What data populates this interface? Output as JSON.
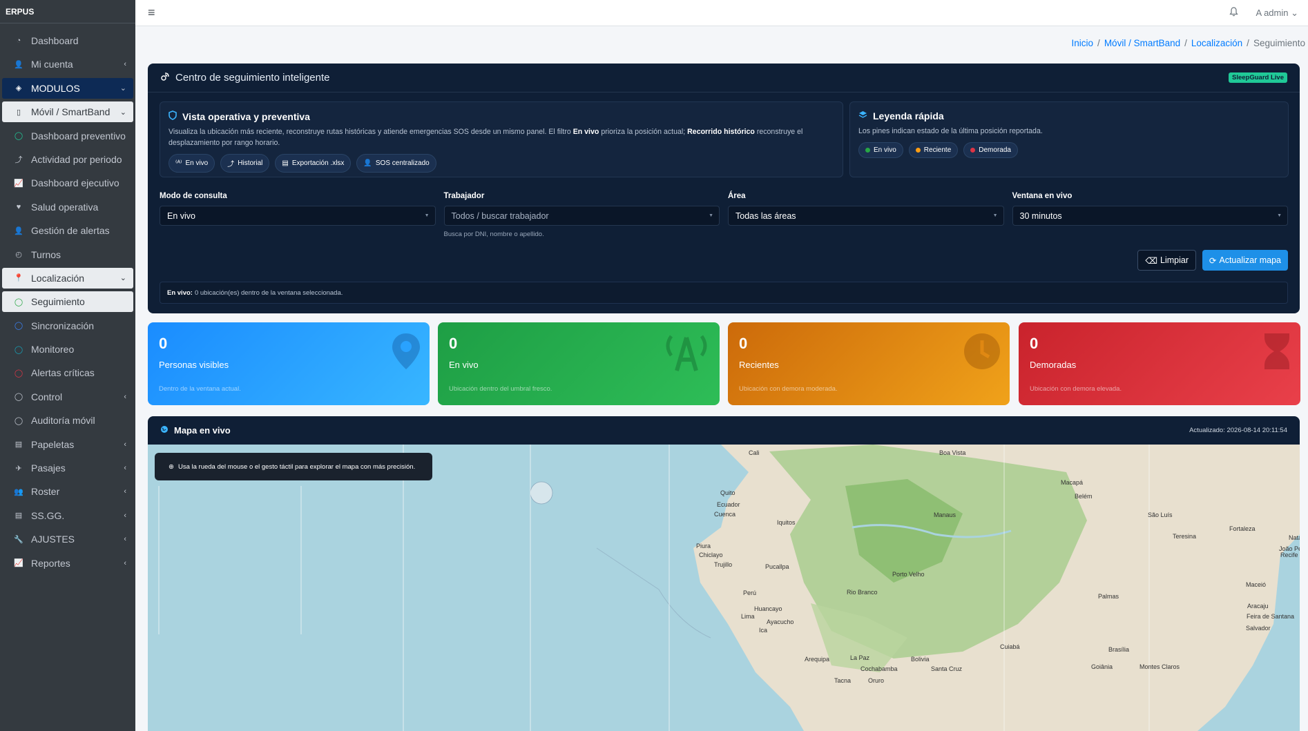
{
  "app": {
    "brand": "ERPUS"
  },
  "sidebar": {
    "items": [
      {
        "label": "Dashboard",
        "icon": "dashboard-icon",
        "arrow": ""
      },
      {
        "label": "Mi cuenta",
        "icon": "user-icon",
        "arrow": "‹"
      },
      {
        "label": "MODULOS",
        "icon": "layers-icon",
        "arrow": "⌄"
      },
      {
        "label": "Móvil / SmartBand",
        "icon": "mobile-icon",
        "arrow": "⌄"
      },
      {
        "label": "Dashboard preventivo",
        "icon": "circle-icon",
        "arrow": ""
      },
      {
        "label": "Actividad por periodo",
        "icon": "route-icon",
        "arrow": ""
      },
      {
        "label": "Dashboard ejecutivo",
        "icon": "chart-icon",
        "arrow": ""
      },
      {
        "label": "Salud operativa",
        "icon": "heart-icon",
        "arrow": ""
      },
      {
        "label": "Gestión de alertas",
        "icon": "user-gear-icon",
        "arrow": ""
      },
      {
        "label": "Turnos",
        "icon": "clock-icon",
        "arrow": ""
      },
      {
        "label": "Localización",
        "icon": "map-pin-icon",
        "arrow": "⌄"
      },
      {
        "label": "Seguimiento",
        "icon": "circle-icon",
        "arrow": ""
      },
      {
        "label": "Sincronización",
        "icon": "circle-icon",
        "arrow": ""
      },
      {
        "label": "Monitoreo",
        "icon": "circle-icon",
        "arrow": ""
      },
      {
        "label": "Alertas críticas",
        "icon": "circle-icon",
        "arrow": ""
      },
      {
        "label": "Control",
        "icon": "circle-icon",
        "arrow": "‹"
      },
      {
        "label": "Auditoría móvil",
        "icon": "circle-icon",
        "arrow": ""
      },
      {
        "label": "Papeletas",
        "icon": "document-icon",
        "arrow": "‹"
      },
      {
        "label": "Pasajes",
        "icon": "plane-icon",
        "arrow": "‹"
      },
      {
        "label": "Roster",
        "icon": "users-icon",
        "arrow": "‹"
      },
      {
        "label": "SS.GG.",
        "icon": "document-icon",
        "arrow": "‹"
      },
      {
        "label": "AJUSTES",
        "icon": "wrench-icon",
        "arrow": "‹"
      },
      {
        "label": "Reportes",
        "icon": "chart-icon",
        "arrow": "‹"
      }
    ]
  },
  "topbar": {
    "user": "A  admin ⌄"
  },
  "breadcrumb": {
    "home": "Inicio",
    "module": "Móvil / SmartBand",
    "section": "Localización",
    "current": "Seguimiento"
  },
  "panel": {
    "title": "Centro de seguimiento inteligente",
    "badge": "SleepGuard Live",
    "overview": {
      "title": "Vista operativa y preventiva",
      "text_1": "Visualiza la ubicación más reciente, reconstruye rutas históricas y atiende emergencias SOS desde un mismo panel. El filtro ",
      "bold_1": "En vivo",
      "text_2": " prioriza la posición actual; ",
      "bold_2": "Recorrido histórico",
      "text_3": " reconstruye el desplazamiento por rango horario.",
      "pills": [
        "En vivo",
        "Historial",
        "Exportación .xlsx",
        "SOS centralizado"
      ]
    },
    "legend": {
      "title": "Leyenda rápida",
      "text": "Los pines indican estado de la última posición reportada.",
      "items": [
        {
          "label": "En vivo",
          "color": "#28a745"
        },
        {
          "label": "Reciente",
          "color": "#fd9d14"
        },
        {
          "label": "Demorada",
          "color": "#dc3545"
        }
      ]
    },
    "filters": {
      "mode_label": "Modo de consulta",
      "mode_value": "En vivo",
      "worker_label": "Trabajador",
      "worker_value": "Todos / buscar trabajador",
      "worker_help": "Busca por DNI, nombre o apellido.",
      "area_label": "Área",
      "area_value": "Todas las áreas",
      "window_label": "Ventana en vivo",
      "window_value": "30 minutos"
    },
    "buttons": {
      "clear": "Limpiar",
      "update": "Actualizar mapa"
    },
    "status": {
      "bold": "En vivo:",
      "text": "0 ubicación(es) dentro de la ventana seleccionada."
    }
  },
  "stats": [
    {
      "value": "0",
      "title": "Personas visibles",
      "sub": "Dentro de la ventana actual.",
      "color_from": "#1a8cff",
      "color_to": "#38b6ff"
    },
    {
      "value": "0",
      "title": "En vivo",
      "sub": "Ubicación dentro del umbral fresco.",
      "color_from": "#1e9e45",
      "color_to": "#2ebd57"
    },
    {
      "value": "0",
      "title": "Recientes",
      "sub": "Ubicación con demora moderada.",
      "color_from": "#cc6a0a",
      "color_to": "#f0a21a"
    },
    {
      "value": "0",
      "title": "Demoradas",
      "sub": "Ubicación con demora elevada.",
      "color_from": "#c9232c",
      "color_to": "#e9404a"
    }
  ],
  "map": {
    "title": "Mapa en vivo",
    "updated": "Actualizado: 2026-08-14 20:11:54",
    "tip": "Usa la rueda del mouse o el gesto táctil para explorar el mapa con más precisión.",
    "labels": [
      {
        "text": "Cali"
      },
      {
        "text": "Boa Vista"
      },
      {
        "text": "Macapá"
      },
      {
        "text": "Quito"
      },
      {
        "text": "Ecuador"
      },
      {
        "text": "Cuenca"
      },
      {
        "text": "Belém"
      },
      {
        "text": "São Luís"
      },
      {
        "text": "Manaus"
      },
      {
        "text": "Iquitos"
      },
      {
        "text": "Fortaleza"
      },
      {
        "text": "Teresina"
      },
      {
        "text": "Natal"
      },
      {
        "text": "João Pessoa"
      },
      {
        "text": "Recife"
      },
      {
        "text": "Piura"
      },
      {
        "text": "Chiclayo"
      },
      {
        "text": "Trujillo"
      },
      {
        "text": "Pucallpa"
      },
      {
        "text": "Porto Velho"
      },
      {
        "text": "Rio Branco"
      },
      {
        "text": "Maceió"
      },
      {
        "text": "Aracaju"
      },
      {
        "text": "Perú"
      },
      {
        "text": "Palmas"
      },
      {
        "text": "Feira de Santana"
      },
      {
        "text": "Huancayo"
      },
      {
        "text": "Lima"
      },
      {
        "text": "Ayacucho"
      },
      {
        "text": "Salvador"
      },
      {
        "text": "Ica"
      },
      {
        "text": "Cuiabá"
      },
      {
        "text": "Brasília"
      },
      {
        "text": "Arequipa"
      },
      {
        "text": "La Paz"
      },
      {
        "text": "Bolivia"
      },
      {
        "text": "Goiânia"
      },
      {
        "text": "Montes Claros"
      },
      {
        "text": "Cochabamba"
      },
      {
        "text": "Santa Cruz"
      },
      {
        "text": "Tacna"
      },
      {
        "text": "Oruro"
      }
    ]
  }
}
